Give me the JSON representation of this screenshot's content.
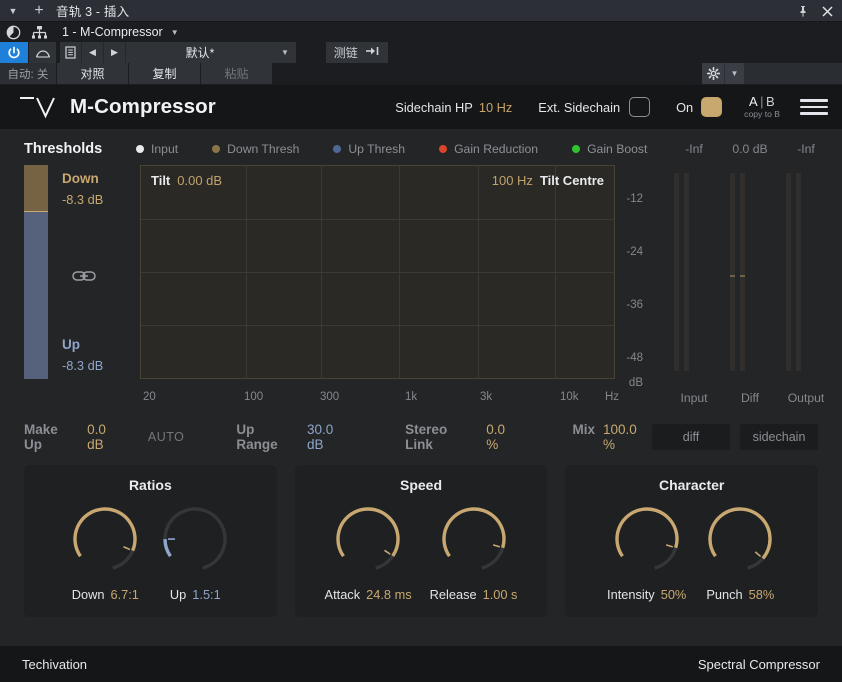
{
  "host": {
    "titlebar": {
      "title": "音轨 3 - 插入",
      "caret_icon": "chevron-down-icon",
      "plus_icon": "plus-icon",
      "pin_icon": "pin-icon",
      "close_icon": "close-icon"
    },
    "row2": {
      "bypass_icon": "power-circle-icon",
      "routing_icon": "routing-icon",
      "plugin_name": "1 - M-Compressor",
      "dropdown_icon": "chevron-down-icon"
    },
    "row3": {
      "power_icon": "power-icon",
      "curve_icon": "automation-curve-icon",
      "list_icon": "preset-list-icon",
      "prev_icon": "prev-icon",
      "next_icon": "next-icon",
      "preset_name": "默认*",
      "preset_dropdown_icon": "chevron-down-icon",
      "sidechain_label": "测链",
      "sidechain_icon": "sidechain-arrow-icon"
    },
    "row4": {
      "auto_label": "自动: 关",
      "compare_label": "对照",
      "copy_label": "复制",
      "paste_label": "粘贴",
      "gear_icon": "gear-icon",
      "gear_dropdown_icon": "chevron-down-icon"
    }
  },
  "plugin": {
    "header": {
      "logo_icon": "techivation-logo-icon",
      "title": "M-Compressor",
      "sidechain_hp_label": "Sidechain HP",
      "sidechain_hp_value": "10 Hz",
      "ext_sidechain_label": "Ext. Sidechain",
      "ext_sidechain_checked": false,
      "on_label": "On",
      "on_checked": true,
      "ab_a": "A",
      "ab_bar": "|",
      "ab_b": "B",
      "ab_sub": "copy to B",
      "menu_icon": "hamburger-menu-icon"
    },
    "legend": {
      "section_title": "Thresholds",
      "items": [
        {
          "label": "Input",
          "color": "#e9eaec"
        },
        {
          "label": "Down Thresh",
          "color": "#8a7348"
        },
        {
          "label": "Up Thresh",
          "color": "#4f6896"
        },
        {
          "label": "Gain Reduction",
          "color": "#d9452a"
        },
        {
          "label": "Gain Boost",
          "color": "#2fc42f"
        }
      ]
    },
    "thresholds": {
      "down_name": "Down",
      "down_value": "-8.3 dB",
      "up_name": "Up",
      "up_value": "-8.3 dB",
      "link_icon": "link-icon",
      "down_color": "#c8a870",
      "up_color": "#8fa5c9"
    },
    "graph": {
      "tilt_label": "Tilt",
      "tilt_value": "0.00 dB",
      "tilt_centre_value": "100 Hz",
      "tilt_centre_label": "Tilt Centre"
    },
    "meters": {
      "headers": [
        "-Inf",
        "0.0 dB",
        "-Inf"
      ],
      "footers": [
        "Input",
        "Diff",
        "Output"
      ]
    },
    "params": {
      "make_up_label": "Make Up",
      "make_up_value": "0.0 dB",
      "auto_label": "AUTO",
      "up_range_label": "Up Range",
      "up_range_value": "30.0 dB",
      "stereo_link_label": "Stereo Link",
      "stereo_link_value": "0.0 %",
      "mix_label": "Mix",
      "mix_value": "100.0 %",
      "diff_button": "diff",
      "sidechain_button": "sidechain"
    },
    "panels": [
      {
        "title": "Ratios",
        "knobs": [
          {
            "name": "Down",
            "value": "6.7:1",
            "color": "#c8a870",
            "fraction": 0.82,
            "pointer": 0.82
          },
          {
            "name": "Up",
            "value": "1.5:1",
            "color": "#8fa5c9",
            "fraction": 0.12,
            "pointer": 0.12
          }
        ]
      },
      {
        "title": "Speed",
        "knobs": [
          {
            "name": "Attack",
            "value": "24.8 ms",
            "color": "#c8a870",
            "fraction": 0.86,
            "pointer": 0.86
          },
          {
            "name": "Release",
            "value": "1.00 s",
            "color": "#c8a870",
            "fraction": 0.8,
            "pointer": 0.8
          }
        ]
      },
      {
        "title": "Character",
        "knobs": [
          {
            "name": "Intensity",
            "value": "50%",
            "color": "#c8a870",
            "fraction": 0.8,
            "pointer": 0.8
          },
          {
            "name": "Punch",
            "value": "58%",
            "color": "#c8a870",
            "fraction": 0.88,
            "pointer": 0.88
          }
        ]
      }
    ],
    "footer": {
      "brand": "Techivation",
      "product": "Spectral Compressor"
    },
    "axes": {
      "freq_ticks": [
        {
          "label": "20",
          "pos": 3
        },
        {
          "label": "100",
          "pos": 104
        },
        {
          "label": "300",
          "pos": 180
        },
        {
          "label": "1k",
          "pos": 265
        },
        {
          "label": "3k",
          "pos": 340
        },
        {
          "label": "10k",
          "pos": 420
        },
        {
          "label": "Hz",
          "pos": 465
        }
      ],
      "db_ticks": [
        {
          "label": "-12",
          "pos": 35
        },
        {
          "label": "-24",
          "pos": 88
        },
        {
          "label": "-36",
          "pos": 141
        },
        {
          "label": "-48",
          "pos": 194
        },
        {
          "label": "dB",
          "pos": 240
        }
      ]
    }
  }
}
